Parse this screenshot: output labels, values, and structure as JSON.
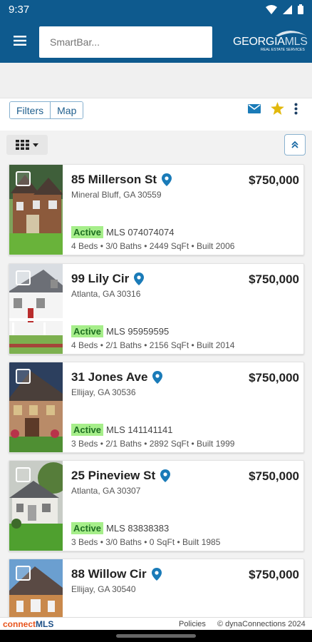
{
  "status_bar": {
    "time": "9:37"
  },
  "header": {
    "search_placeholder": "SmartBar...",
    "logo_main": "GEORGIA",
    "logo_accent": "MLS",
    "logo_sub": "REAL ESTATE SERVICES"
  },
  "toolbar": {
    "filters_label": "Filters",
    "map_label": "Map",
    "icons": [
      "mail-icon",
      "star-icon",
      "more-vert-icon"
    ]
  },
  "colors": {
    "primary": "#0e5a8e",
    "active_badge_bg": "#a6ee8a",
    "active_badge_text": "#1e6e22",
    "pin": "#1a7bb8",
    "star": "#e2b80c"
  },
  "listings": [
    {
      "address": "85 Millerson St",
      "city": "Mineral Bluff, GA 30559",
      "price": "$750,000",
      "status": "Active",
      "mls": "MLS 074074074",
      "details": "4 Beds • 3/0 Baths • 2449 SqFt • Built 2006"
    },
    {
      "address": "99 Lily Cir",
      "city": "Atlanta, GA 30316",
      "price": "$750,000",
      "status": "Active",
      "mls": "MLS 95959595",
      "details": "4 Beds • 2/1 Baths • 2156 SqFt • Built 2014"
    },
    {
      "address": "31 Jones Ave",
      "city": "Ellijay, GA 30536",
      "price": "$750,000",
      "status": "Active",
      "mls": "MLS 141141141",
      "details": "3 Beds • 2/1 Baths • 2892 SqFt • Built 1999"
    },
    {
      "address": "25 Pineview St",
      "city": "Atlanta, GA 30307",
      "price": "$750,000",
      "status": "Active",
      "mls": "MLS 83838383",
      "details": "3 Beds • 3/0 Baths • 0 SqFt • Built 1985"
    },
    {
      "address": "88 Willow Cir",
      "city": "Ellijay, GA 30540",
      "price": "$750,000"
    }
  ],
  "footer": {
    "brand_part1": "connect",
    "brand_part2": "MLS",
    "policies": "Policies",
    "copyright": "© dynaConnections 2024"
  }
}
